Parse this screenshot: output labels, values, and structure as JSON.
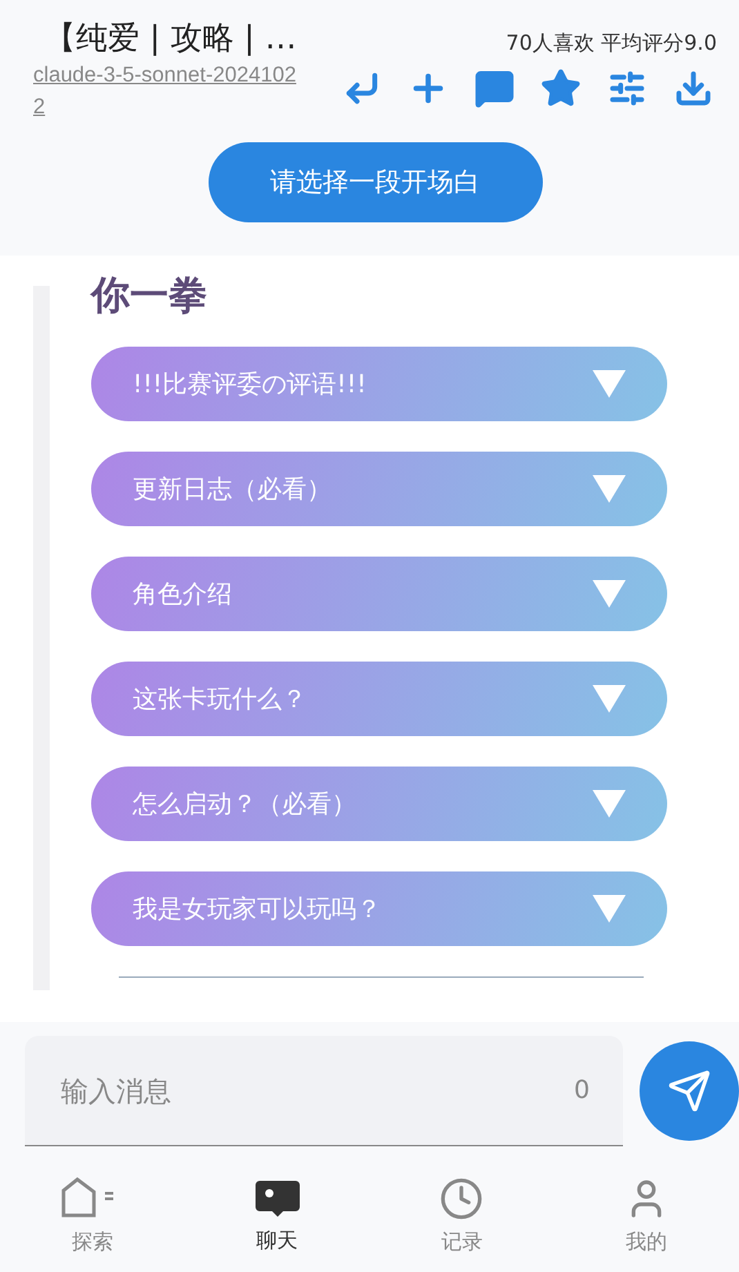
{
  "header": {
    "title": "【纯爱 | 攻略 | …",
    "model": "claude-3-5-sonnet-20241022",
    "stats": "70人喜欢 平均评分9.0"
  },
  "opening_button": "请选择一段开场白",
  "card": {
    "heading": "你一拳",
    "sections": [
      {
        "label": "!!!比赛评委の评语!!!",
        "expanded": false
      },
      {
        "label": "更新日志（必看）",
        "expanded": false
      },
      {
        "label": "角色介绍",
        "expanded": false
      },
      {
        "label": "这张卡玩什么？",
        "expanded": false
      },
      {
        "label": "怎么启动？（必看）",
        "expanded": false
      },
      {
        "label": "我是女玩家可以玩吗？",
        "expanded": false
      }
    ]
  },
  "composer": {
    "placeholder": "输入消息",
    "count": "0"
  },
  "nav": [
    {
      "kind": "explore",
      "label": "探索",
      "selected": false
    },
    {
      "kind": "chat",
      "label": "聊天",
      "selected": true
    },
    {
      "kind": "history",
      "label": "记录",
      "selected": false
    },
    {
      "kind": "me",
      "label": "我的",
      "selected": false
    }
  ]
}
